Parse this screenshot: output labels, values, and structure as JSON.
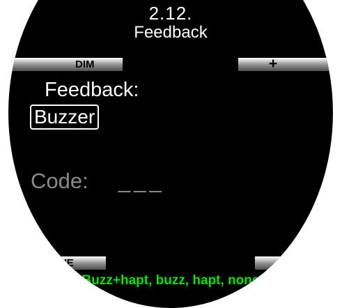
{
  "header": {
    "section_number": "2.12.",
    "title": "Feedback"
  },
  "softkeys": {
    "top_left": "DIM",
    "top_right": "+",
    "bottom_left": "SAVE",
    "bottom_right": "−"
  },
  "settings": {
    "feedback_label": "Feedback:",
    "feedback_value": "Buzzer",
    "code_label": "Code:",
    "code_value": "___"
  },
  "footer": {
    "hint": "Buzz+hapt, buzz, hapt, none"
  },
  "colors": {
    "screen": "#000000",
    "text": "#ffffff",
    "inactive_text": "#8a8a8a",
    "hint_text": "#00e600"
  }
}
